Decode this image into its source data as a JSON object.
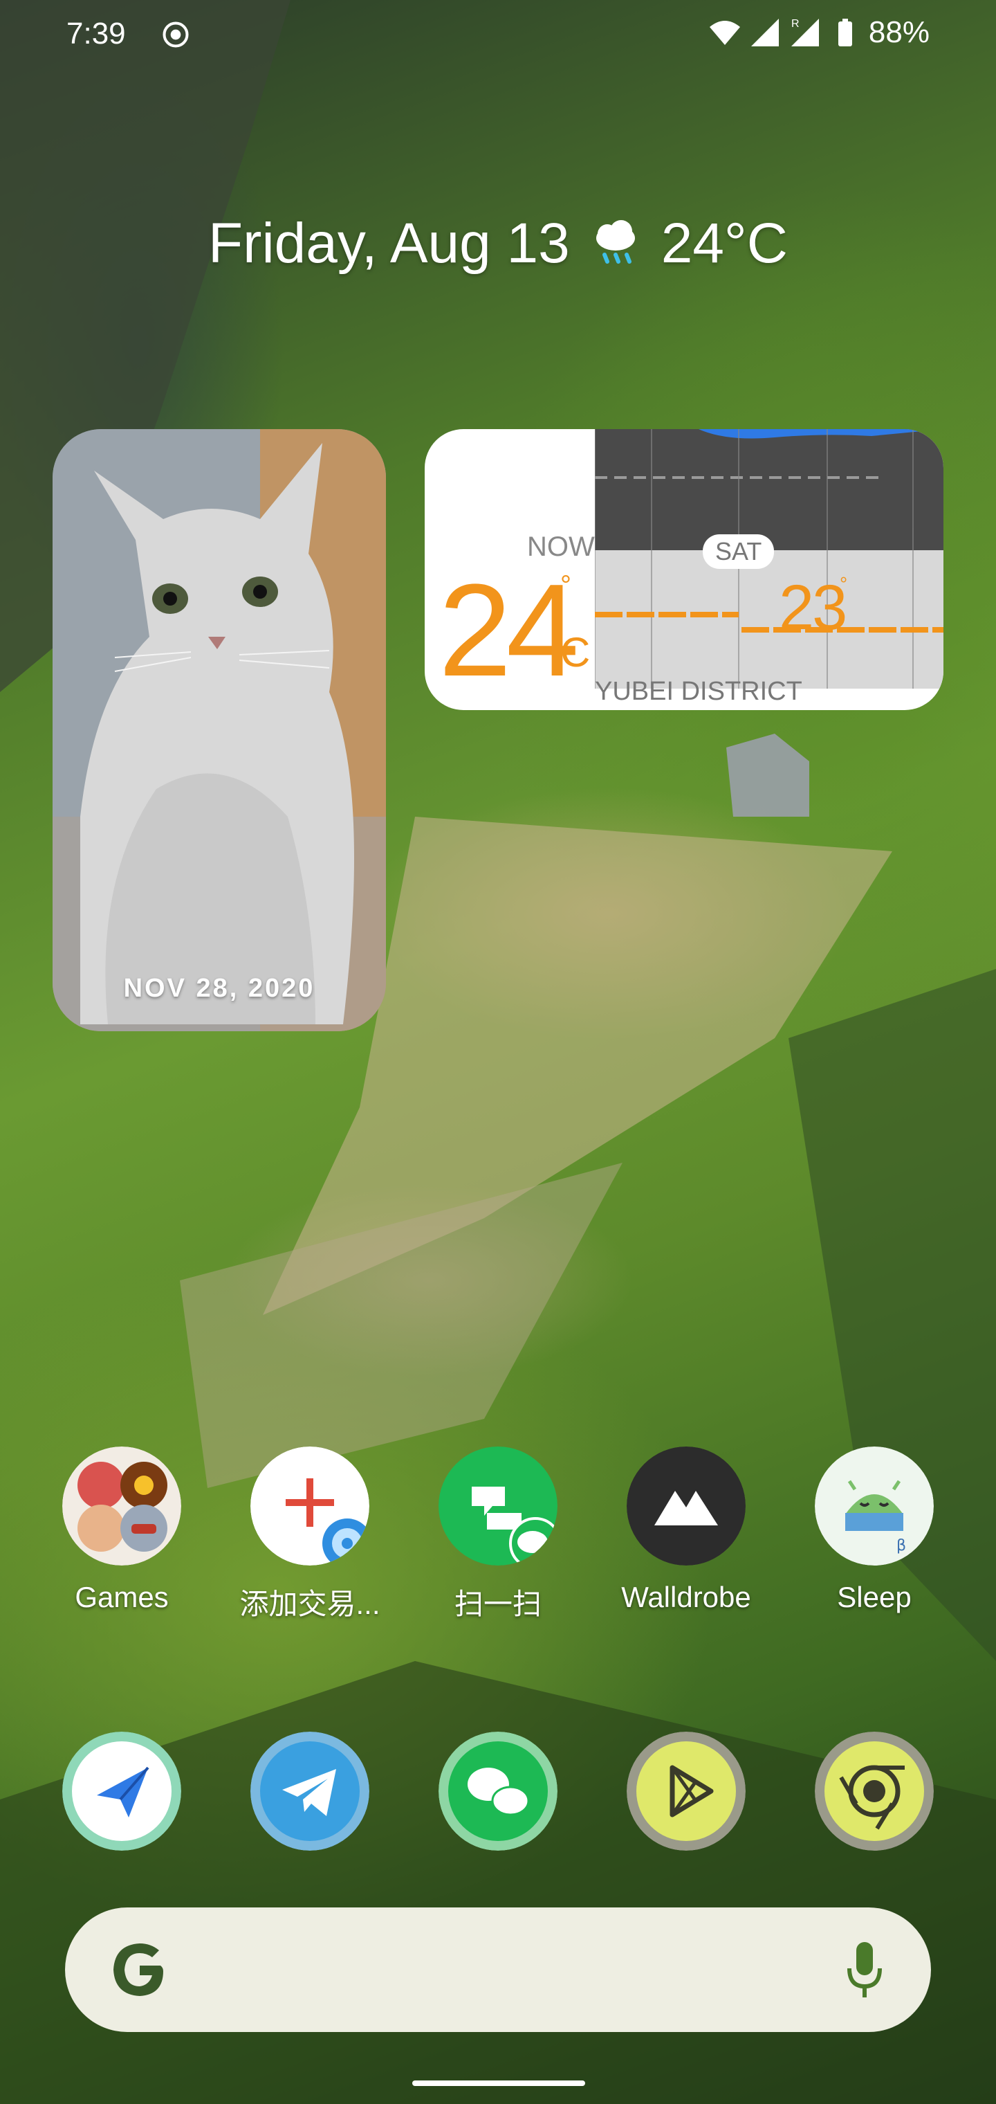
{
  "status_bar": {
    "time": "7:39",
    "battery": "88%",
    "icons": [
      "screen-record-icon",
      "wifi-icon",
      "signal-icon",
      "roaming-signal-icon",
      "battery-icon"
    ]
  },
  "glance": {
    "date": "Friday, Aug 13",
    "temperature": "24°C",
    "weather_icon": "rain-cloud-icon"
  },
  "photo_widget": {
    "date": "NOV 28, 2020"
  },
  "weather_widget": {
    "now_label": "NOW",
    "current_temp": "24",
    "degree": "°",
    "unit": "C",
    "day_label": "SAT",
    "next_temp": "23",
    "next_degree": "°",
    "location": "YUBEI DISTRICT",
    "accent_color": "#f2941b"
  },
  "apps": [
    {
      "label": "Games",
      "icon": "games-folder-icon"
    },
    {
      "label": "添加交易...",
      "icon": "add-transaction-icon"
    },
    {
      "label": "扫一扫",
      "icon": "wechat-scan-icon"
    },
    {
      "label": "Walldrobe",
      "icon": "walldrobe-icon"
    },
    {
      "label": "Sleep",
      "icon": "sleep-android-icon"
    }
  ],
  "dock": [
    {
      "icon": "send-paper-plane-icon"
    },
    {
      "icon": "telegram-icon"
    },
    {
      "icon": "wechat-icon"
    },
    {
      "icon": "play-store-icon"
    },
    {
      "icon": "chrome-icon"
    }
  ],
  "search": {
    "logo": "google-g-icon",
    "mic": "mic-icon"
  }
}
